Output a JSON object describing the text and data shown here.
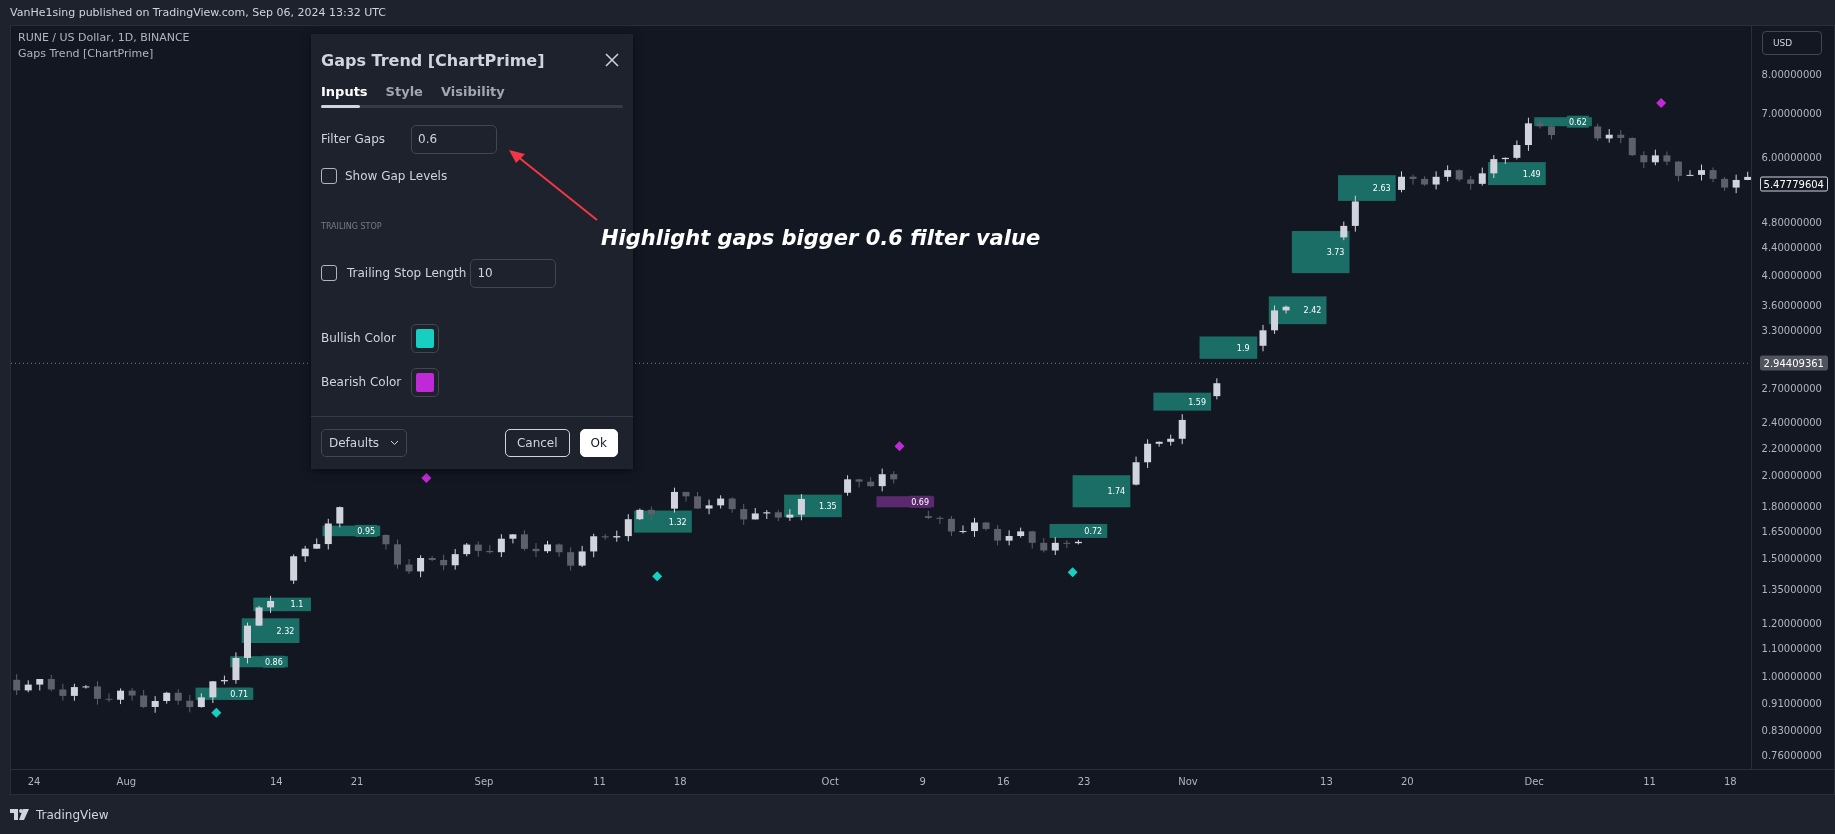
{
  "header": {
    "text": "VanHe1sing published on TradingView.com, Sep 06, 2024 13:32 UTC"
  },
  "chart": {
    "symbol": "RUNE / US Dollar, 1D, BINANCE",
    "indicator": "Gaps Trend [ChartPrime]",
    "currency": "USD",
    "price_ticks": [
      "8.00000000",
      "7.00000000",
      "6.00000000",
      "4.80000000",
      "4.40000000",
      "4.00000000",
      "3.60000000",
      "3.30000000",
      "2.70000000",
      "2.40000000",
      "2.20000000",
      "2.00000000",
      "1.80000000",
      "1.65000000",
      "1.50000000",
      "1.35000000",
      "1.20000000",
      "1.10000000",
      "1.00000000",
      "0.91000000",
      "0.83000000",
      "0.76000000"
    ],
    "last_price": "5.47779604",
    "crosshair_price": "2.94409361",
    "time_ticks": [
      "24",
      "Aug",
      "14",
      "21",
      "Sep",
      "11",
      "18",
      "Oct",
      "9",
      "16",
      "23",
      "Nov",
      "13",
      "20",
      "Dec",
      "11",
      "18"
    ],
    "gaps": [
      {
        "label": "0.71",
        "kind": "bullish"
      },
      {
        "label": "0.86",
        "kind": "bullish"
      },
      {
        "label": "2.32",
        "kind": "bullish"
      },
      {
        "label": "1.1",
        "kind": "bullish"
      },
      {
        "label": "0.95",
        "kind": "bullish"
      },
      {
        "label": "1.32",
        "kind": "bullish"
      },
      {
        "label": "1.35",
        "kind": "bullish"
      },
      {
        "label": "0.69",
        "kind": "bearish"
      },
      {
        "label": "0.72",
        "kind": "bullish"
      },
      {
        "label": "1.74",
        "kind": "bullish"
      },
      {
        "label": "1.59",
        "kind": "bullish"
      },
      {
        "label": "1.9",
        "kind": "bullish"
      },
      {
        "label": "2.42",
        "kind": "bullish"
      },
      {
        "label": "3.73",
        "kind": "bullish"
      },
      {
        "label": "2.63",
        "kind": "bullish"
      },
      {
        "label": "1.49",
        "kind": "bullish"
      },
      {
        "label": "0.62",
        "kind": "bullish"
      }
    ],
    "signals": [
      {
        "kind": "bullish"
      },
      {
        "kind": "bearish"
      },
      {
        "kind": "bullish"
      },
      {
        "kind": "bearish"
      },
      {
        "kind": "bullish"
      },
      {
        "kind": "bearish"
      }
    ]
  },
  "dialog": {
    "title": "Gaps Trend [ChartPrime]",
    "tabs": [
      {
        "label": "Inputs",
        "selected": true
      },
      {
        "label": "Style",
        "selected": false
      },
      {
        "label": "Visibility",
        "selected": false
      }
    ],
    "filter_gaps": {
      "label": "Filter Gaps",
      "value": "0.6"
    },
    "show_gap_levels": {
      "label": "Show Gap Levels",
      "checked": false
    },
    "section": "TRAILING STOP",
    "trailing_stop": {
      "label": "Trailing Stop Length",
      "checked": false,
      "value": "10"
    },
    "colors": [
      {
        "label": "Bullish Color",
        "color": "#17cfc0"
      },
      {
        "label": "Bearish Color",
        "color": "#c02ad6"
      }
    ],
    "defaults": "Defaults",
    "cancel": "Cancel",
    "ok": "Ok"
  },
  "annotation": {
    "text": "Highlight gaps bigger 0.6 filter value"
  },
  "footer": {
    "brand": "TradingView"
  }
}
